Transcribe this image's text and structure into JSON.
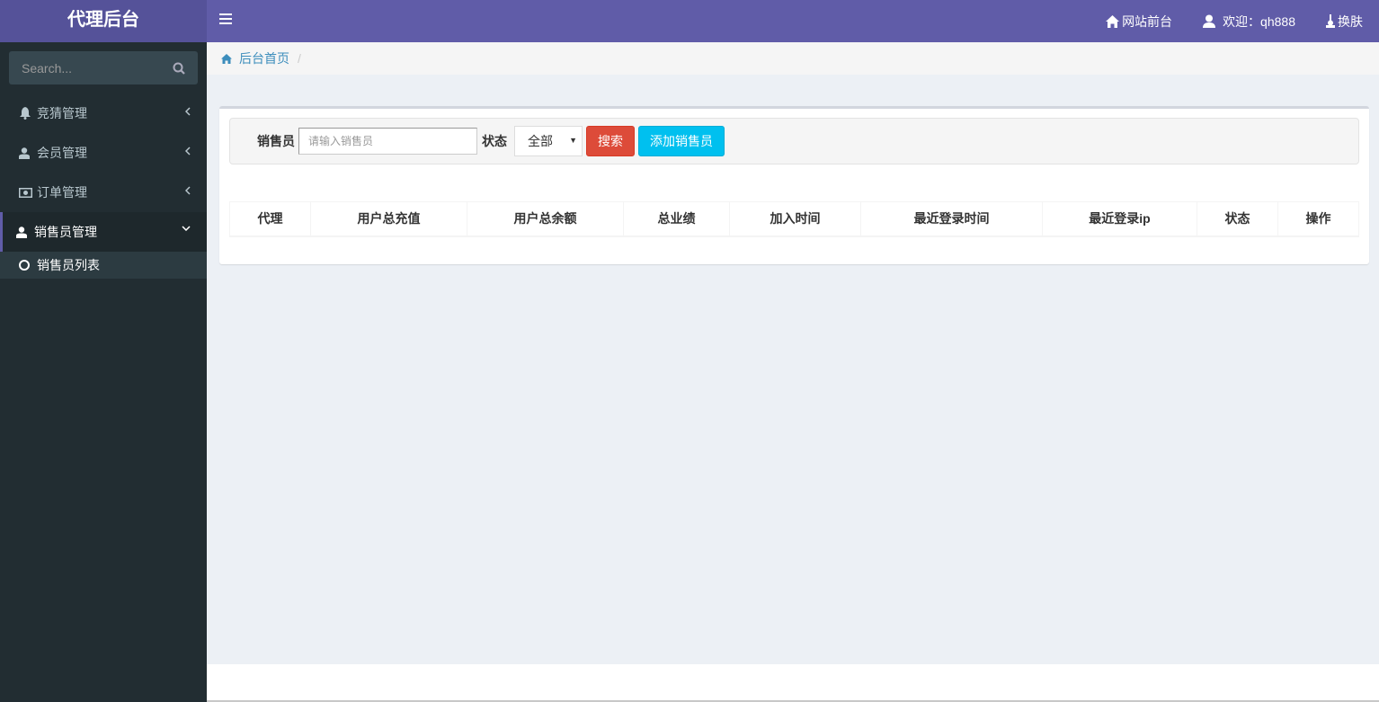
{
  "app": {
    "title": "代理后台"
  },
  "topbar": {
    "home_link": "网站前台",
    "welcome": "欢迎：qh888",
    "skin": "换肤"
  },
  "sidebar": {
    "search_placeholder": "Search...",
    "items": [
      {
        "label": "竞猜管理",
        "icon": "bell-icon",
        "expanded": false
      },
      {
        "label": "会员管理",
        "icon": "user-icon",
        "expanded": false
      },
      {
        "label": "订单管理",
        "icon": "money-icon",
        "expanded": false
      },
      {
        "label": "销售员管理",
        "icon": "user-icon",
        "expanded": true,
        "active": true
      }
    ],
    "subitems": [
      {
        "label": "销售员列表"
      }
    ]
  },
  "breadcrumb": {
    "home": "后台首页",
    "separator": "/"
  },
  "filter": {
    "seller_label": "销售员",
    "seller_placeholder": "请输入销售员",
    "seller_value": "",
    "status_label": "状态",
    "status_selected": "全部",
    "search_button": "搜索",
    "add_button": "添加销售员"
  },
  "table": {
    "columns": [
      "代理",
      "用户总充值",
      "用户总余额",
      "总业绩",
      "加入时间",
      "最近登录时间",
      "最近登录ip",
      "状态",
      "操作"
    ],
    "rows": []
  },
  "colors": {
    "header": "#605ca8",
    "logo": "#555299",
    "sidebar": "#222d32",
    "danger": "#dd4b39",
    "info": "#00c0ef",
    "link": "#3c8dbc"
  }
}
